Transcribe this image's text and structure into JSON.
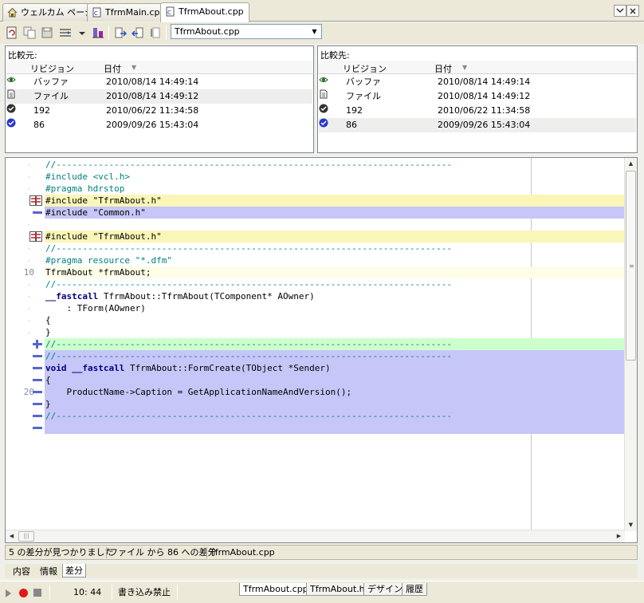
{
  "doc_tabs": [
    {
      "label": "ウェルカム ページ",
      "icon": "home-icon"
    },
    {
      "label": "TfrmMain.cpp",
      "icon": "cpp-file-icon"
    },
    {
      "label": "TfrmAbout.cpp",
      "icon": "cpp-file-icon"
    }
  ],
  "active_tab": "TfrmAbout.cpp",
  "toolbar": {
    "file_selector": "TfrmAbout.cpp"
  },
  "source_panel": {
    "title": "比較元:",
    "col_revision": "リビジョン",
    "col_date": "日付",
    "rows": [
      {
        "revision": "バッファ",
        "date": "2010/08/14 14:49:14",
        "icon": "eye-icon"
      },
      {
        "revision": "ファイル",
        "date": "2010/08/14 14:49:12",
        "icon": "file-icon"
      },
      {
        "revision": "192",
        "date": "2010/06/22 11:34:58",
        "icon": "check-dark-icon"
      },
      {
        "revision": "86",
        "date": "2009/09/26 15:43:04",
        "icon": "check-blue-icon"
      }
    ]
  },
  "target_panel": {
    "title": "比較先:",
    "col_revision": "リビジョン",
    "col_date": "日付",
    "rows": [
      {
        "revision": "バッファ",
        "date": "2010/08/14 14:49:14",
        "icon": "eye-icon"
      },
      {
        "revision": "ファイル",
        "date": "2010/08/14 14:49:12",
        "icon": "file-icon"
      },
      {
        "revision": "192",
        "date": "2010/06/22 11:34:58",
        "icon": "check-dark-icon"
      },
      {
        "revision": "86",
        "date": "2009/09/26 15:43:04",
        "icon": "check-blue-icon"
      }
    ]
  },
  "code_lines": [
    {
      "text": "//---------------------------------------------------------------------------",
      "kind": "comment",
      "state": "normal"
    },
    {
      "text": "#include <vcl.h>",
      "kind": "pp",
      "state": "normal"
    },
    {
      "text": "#pragma hdrstop",
      "kind": "pp",
      "state": "normal"
    },
    {
      "text": "#include \"TfrmAbout.h\"",
      "kind": "plain",
      "state": "changed"
    },
    {
      "text": "#include \"Common.h\"",
      "kind": "plain",
      "state": "deleted"
    },
    {
      "text": "",
      "kind": "plain",
      "state": "normal"
    },
    {
      "text": "#include \"TfrmAbout.h\"",
      "kind": "plain",
      "state": "changed"
    },
    {
      "text": "//---------------------------------------------------------------------------",
      "kind": "comment",
      "state": "normal"
    },
    {
      "text": "#pragma resource \"*.dfm\"",
      "kind": "pp",
      "state": "normal"
    },
    {
      "text": "TfrmAbout *frmAbout;",
      "kind": "plain",
      "state": "current"
    },
    {
      "text": "//---------------------------------------------------------------------------",
      "kind": "comment",
      "state": "normal"
    },
    {
      "text": "__fastcall TfrmAbout::TfrmAbout(TComponent* AOwner)",
      "kind": "fastcall",
      "state": "normal"
    },
    {
      "text": "    : TForm(AOwner)",
      "kind": "plain",
      "state": "normal"
    },
    {
      "text": "{",
      "kind": "plain",
      "state": "normal"
    },
    {
      "text": "}",
      "kind": "plain",
      "state": "normal"
    },
    {
      "text": "//---------------------------------------------------------------------------",
      "kind": "comment",
      "state": "added"
    },
    {
      "text": "//---------------------------------------------------------------------------",
      "kind": "comment",
      "state": "deleted"
    },
    {
      "text": "void __fastcall TfrmAbout::FormCreate(TObject *Sender)",
      "kind": "voidfastcall",
      "state": "deleted"
    },
    {
      "text": "{",
      "kind": "plain",
      "state": "deleted"
    },
    {
      "text": "    ProductName->Caption = GetApplicationNameAndVersion();",
      "kind": "plain",
      "state": "deleted"
    },
    {
      "text": "}",
      "kind": "plain",
      "state": "deleted"
    },
    {
      "text": "//---------------------------------------------------------------------------",
      "kind": "comment",
      "state": "deleted"
    },
    {
      "text": "",
      "kind": "plain",
      "state": "deleted"
    }
  ],
  "gutter": {
    "line_numbers": {
      "9": "10",
      "19": "20"
    }
  },
  "status": {
    "diff_count": "5 の差分が見つかりました",
    "diff_desc": "ファイル から 86 への差分",
    "file": "TfrmAbout.cpp"
  },
  "view_tabs": [
    "内容",
    "情報",
    "差分"
  ],
  "active_view_tab": "差分",
  "bottom": {
    "cursor_pos": "10:  44",
    "mode": "書き込み禁止",
    "file_tabs": [
      "TfrmAbout.cpp",
      "TfrmAbout.h",
      "デザイン",
      "履歴"
    ],
    "active_file_tab": "TfrmAbout.cpp"
  },
  "colors": {
    "changed": "#faf6b8",
    "deleted": "#c6c6f8",
    "added": "#ccffcc",
    "comment": "#008080",
    "keyword": "#000080"
  }
}
